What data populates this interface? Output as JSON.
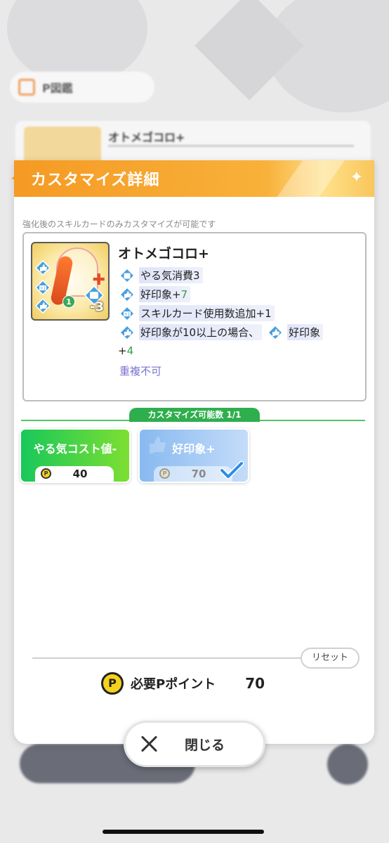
{
  "background": {
    "pbook_label": "P図鑑",
    "card_title": "オトメゴコロ+"
  },
  "modal": {
    "title": "カスタマイズ詳細",
    "note": "強化後のスキルカードのみカスタマイズが可能です",
    "card": {
      "name": "オトメゴコロ+",
      "art_number": "1",
      "art_cost": "-3",
      "effects": [
        {
          "icon": "fist-icon",
          "text": "やる気消費3",
          "suffix": ""
        },
        {
          "icon": "thumbs-up-icon",
          "text": "好印象+",
          "suffix": "7"
        },
        {
          "icon": "card-add-icon",
          "text": "スキルカード使用数追加+1",
          "suffix": ""
        }
      ],
      "conditional": {
        "prefix": "好印象が10以上の場合、",
        "target": "好印象",
        "tail": "+",
        "tail_value": "4"
      },
      "unique": "重複不可"
    },
    "customize": {
      "tab_label": "カスタマイズ可能数 1/1",
      "options": [
        {
          "label": "やる気コスト値-",
          "cost": "40",
          "selected": false
        },
        {
          "label": "好印象+",
          "cost": "70",
          "selected": true
        }
      ]
    },
    "reset_label": "リセット",
    "required_points_label": "必要Pポイント",
    "required_points_value": "70",
    "coin_symbol": "P"
  },
  "close_label": "閉じる",
  "colors": {
    "header_orange": "#f59a24",
    "green": "#2fae4e",
    "effect_value_green": "#2fa24a",
    "unique_purple": "#7a72cf",
    "selected_blue": "#88b9f0"
  }
}
